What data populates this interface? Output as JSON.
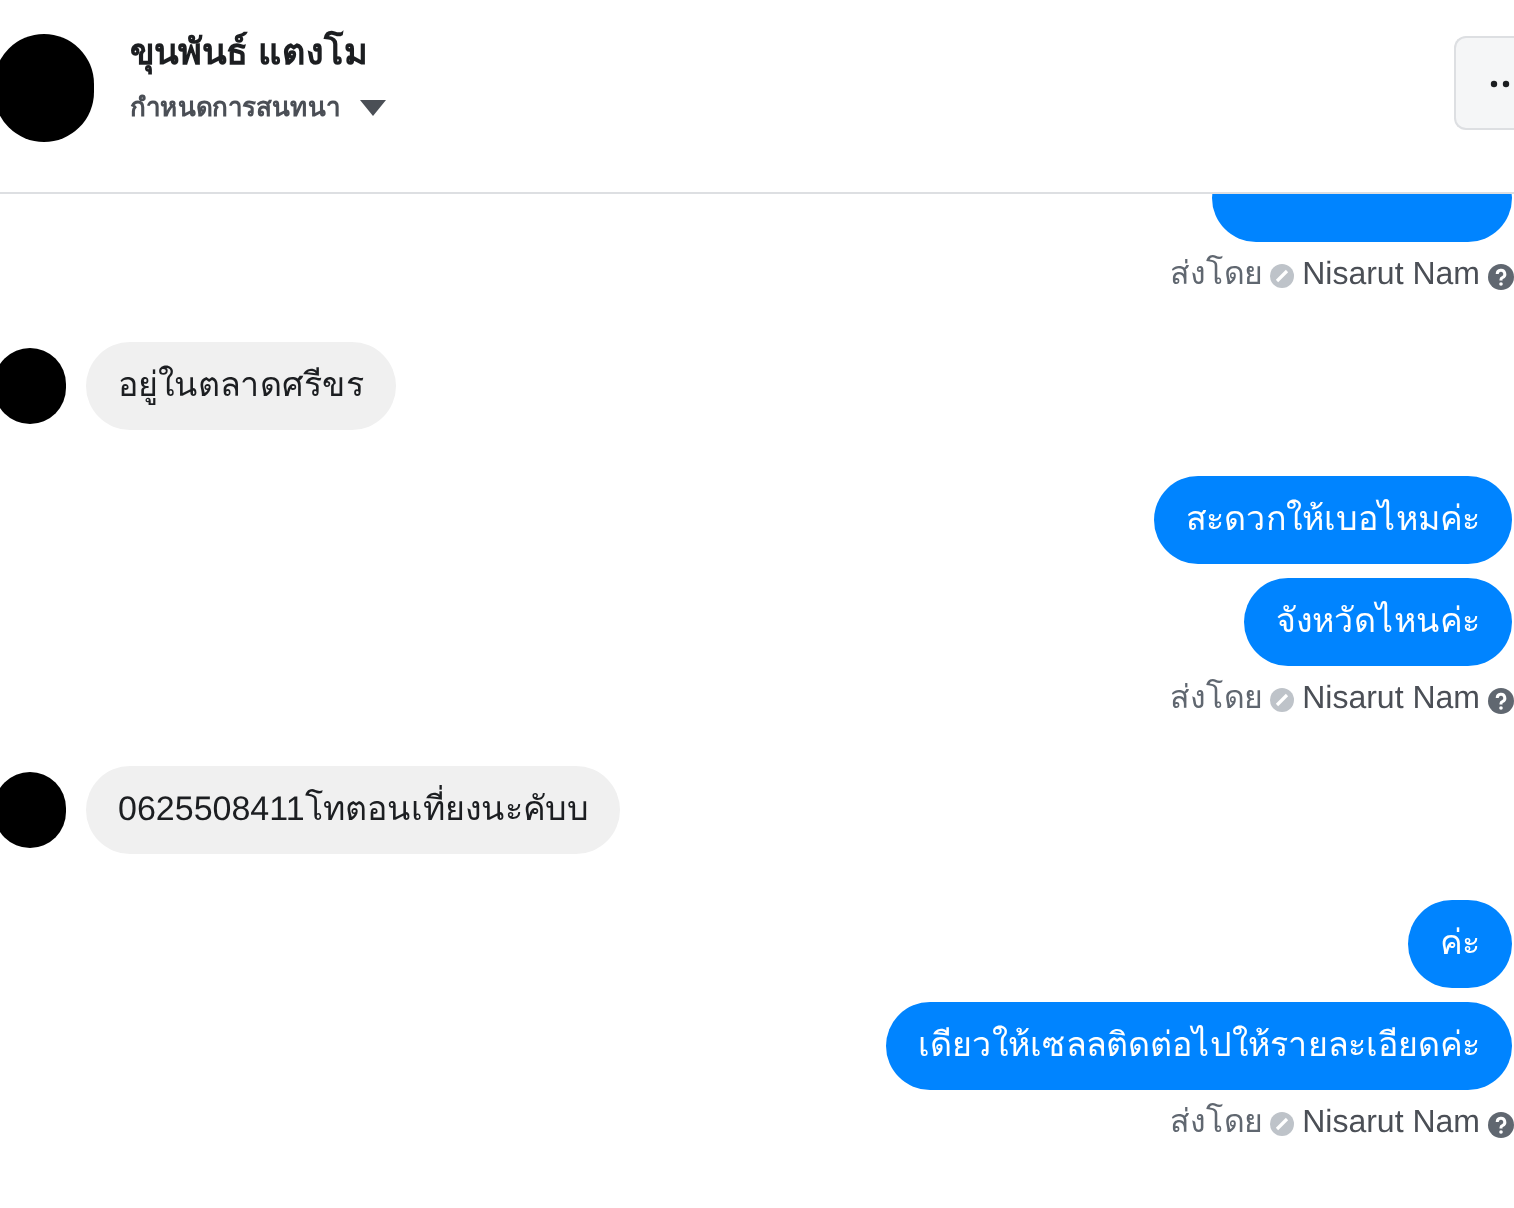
{
  "header": {
    "title": "ขุนพันธ์ แตงโม",
    "subtitle": "กำหนดการสนทนา"
  },
  "messages": [
    {
      "kind": "outgoing"
    },
    {
      "kind": "sent_by",
      "label": "ส่งโดย",
      "name": "Nisarut Nam"
    },
    {
      "kind": "incoming",
      "text": "อยู่ในตลาดศรีขร"
    },
    {
      "kind": "outgoing",
      "text": "สะดวกให้เบอไหมค่ะ"
    },
    {
      "kind": "outgoing",
      "text": "จังหวัดไหนค่ะ"
    },
    {
      "kind": "sent_by",
      "label": "ส่งโดย",
      "name": "Nisarut Nam"
    },
    {
      "kind": "incoming",
      "text": "0625508411โทตอนเที่ยงนะคับบ"
    },
    {
      "kind": "outgoing",
      "text": "ค่ะ"
    },
    {
      "kind": "outgoing",
      "text": "เดียวให้เซลลติดต่อไปให้รายละเอียดค่ะ"
    },
    {
      "kind": "sent_by",
      "label": "ส่งโดย",
      "name": "Nisarut Nam"
    }
  ]
}
